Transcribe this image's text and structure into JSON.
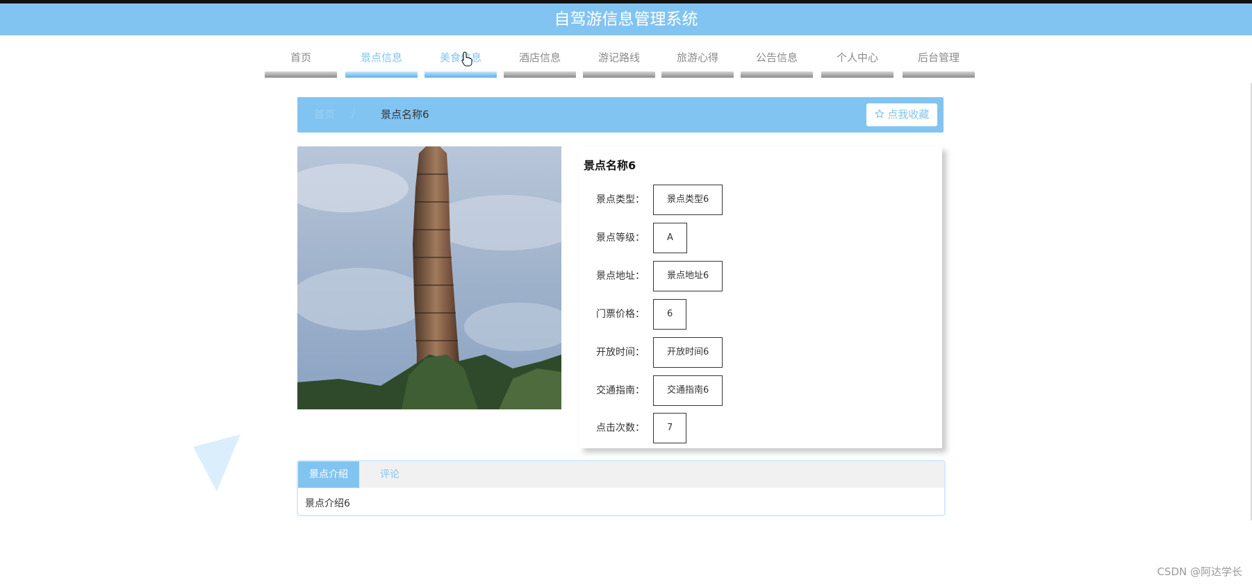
{
  "header": {
    "title": "自驾游信息管理系统"
  },
  "nav": {
    "items": [
      {
        "label": "首页",
        "active": false
      },
      {
        "label": "景点信息",
        "active": true
      },
      {
        "label": "美食信息",
        "active": true
      },
      {
        "label": "酒店信息",
        "active": false
      },
      {
        "label": "游记路线",
        "active": false
      },
      {
        "label": "旅游心得",
        "active": false
      },
      {
        "label": "公告信息",
        "active": false
      },
      {
        "label": "个人中心",
        "active": false
      },
      {
        "label": "后台管理",
        "active": false
      }
    ]
  },
  "breadcrumb": {
    "home": "首页",
    "separator": "/",
    "current": "景点名称6"
  },
  "favorite": {
    "icon": "star-outline-icon",
    "label": "点我收藏"
  },
  "detail": {
    "title": "景点名称6",
    "fields": [
      {
        "label": "景点类型：",
        "value": "景点类型6"
      },
      {
        "label": "景点等级：",
        "value": "A"
      },
      {
        "label": "景点地址：",
        "value": "景点地址6"
      },
      {
        "label": "门票价格：",
        "value": "6"
      },
      {
        "label": "开放时间：",
        "value": "开放时间6"
      },
      {
        "label": "交通指南：",
        "value": "交通指南6"
      },
      {
        "label": "点击次数：",
        "value": "7"
      }
    ]
  },
  "tabs": {
    "items": [
      {
        "label": "景点介绍",
        "active": true
      },
      {
        "label": "评论",
        "active": false
      }
    ],
    "content": "景点介绍6"
  },
  "watermark": "CSDN @阿达学长",
  "colors": {
    "accent": "#82c4f1",
    "nav_inactive": "#8a8a8a"
  }
}
